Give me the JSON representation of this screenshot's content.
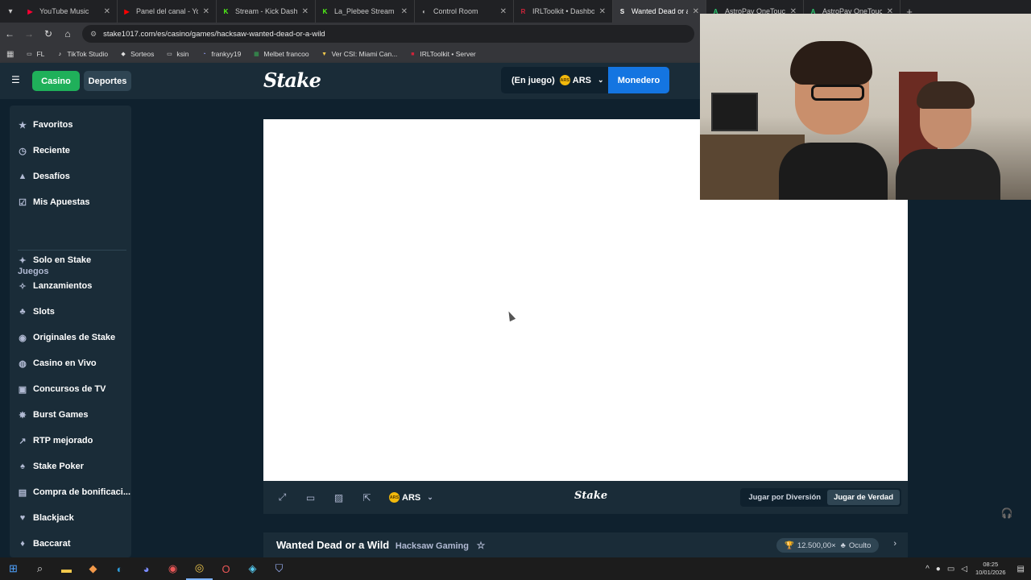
{
  "browser": {
    "tabs": [
      {
        "label": "YouTube Music",
        "favicon_color": "#ff0033",
        "favicon_glyph": "▶"
      },
      {
        "label": "Panel del canal - You",
        "favicon_color": "#ff0000",
        "favicon_glyph": "▶"
      },
      {
        "label": "Stream - Kick Dashbo",
        "favicon_color": "#53fc18",
        "favicon_glyph": "K"
      },
      {
        "label": "La_Plebee Stream - W",
        "favicon_color": "#53fc18",
        "favicon_glyph": "K"
      },
      {
        "label": "Control Room",
        "favicon_color": "#bbbbbb",
        "favicon_glyph": "◐"
      },
      {
        "label": "IRLToolkit • Dashboa",
        "favicon_color": "#d0243a",
        "favicon_glyph": "R"
      },
      {
        "label": "Wanted Dead or a Wil",
        "favicon_color": "#ffffff",
        "favicon_glyph": "S",
        "active": true
      },
      {
        "label": "AstroPay OneTouch",
        "favicon_color": "#2ecc71",
        "favicon_glyph": "A"
      },
      {
        "label": "AstroPay OneTouch",
        "favicon_color": "#2ecc71",
        "favicon_glyph": "A"
      }
    ],
    "url": "stake1017.com/es/casino/games/hacksaw-wanted-dead-or-a-wild",
    "bookmarks": [
      {
        "label": "FL",
        "icon": "folder-icon"
      },
      {
        "label": "TikTok Studio",
        "icon": "tiktok-icon"
      },
      {
        "label": "Sorteos",
        "icon": "diamond-icon"
      },
      {
        "label": "ksin",
        "icon": "folder-icon"
      },
      {
        "label": "frankyy19",
        "icon": "twitch-icon"
      },
      {
        "label": "Melbet francoo",
        "icon": "sheets-icon"
      },
      {
        "label": "Ver CSI: Miami Can...",
        "icon": "tv-icon"
      },
      {
        "label": "IRLToolkit • Server",
        "icon": "irl-icon"
      }
    ]
  },
  "header": {
    "casino_label": "Casino",
    "deportes_label": "Deportes",
    "logo_text": "Stake",
    "wallet_status": "(En juego)",
    "currency": "ARS",
    "coin_label": "ARS",
    "monedero_label": "Monedero"
  },
  "sidebar": {
    "top_items": [
      {
        "label": "Favoritos",
        "icon": "star-icon"
      },
      {
        "label": "Reciente",
        "icon": "clock-icon"
      },
      {
        "label": "Desafíos",
        "icon": "challenge-icon"
      },
      {
        "label": "Mis Apuestas",
        "icon": "bets-icon"
      }
    ],
    "section_title": "Juegos",
    "game_items": [
      {
        "label": "Solo en Stake",
        "icon": "stake-icon"
      },
      {
        "label": "Lanzamientos",
        "icon": "sparkle-icon"
      },
      {
        "label": "Slots",
        "icon": "slots-icon"
      },
      {
        "label": "Originales de Stake",
        "icon": "originals-icon"
      },
      {
        "label": "Casino en Vivo",
        "icon": "live-icon"
      },
      {
        "label": "Concursos de TV",
        "icon": "tv-icon"
      },
      {
        "label": "Burst Games",
        "icon": "burst-icon"
      },
      {
        "label": "RTP mejorado",
        "icon": "rtp-icon"
      },
      {
        "label": "Stake Poker",
        "icon": "poker-icon"
      },
      {
        "label": "Compra de bonificaci...",
        "icon": "gift-icon"
      },
      {
        "label": "Blackjack",
        "icon": "cards-icon"
      },
      {
        "label": "Baccarat",
        "icon": "baccarat-icon"
      }
    ]
  },
  "gamebar": {
    "currency": "ARS",
    "logo_text": "Stake",
    "mode_fun": "Jugar por Diversión",
    "mode_real": "Jugar de Verdad"
  },
  "game_info": {
    "title": "Wanted Dead or a Wild",
    "provider": "Hacksaw Gaming",
    "max_win": "12.500,00×",
    "volatility": "Oculto"
  },
  "taskbar": {
    "time": "08:25",
    "date": "10/01/2026"
  }
}
